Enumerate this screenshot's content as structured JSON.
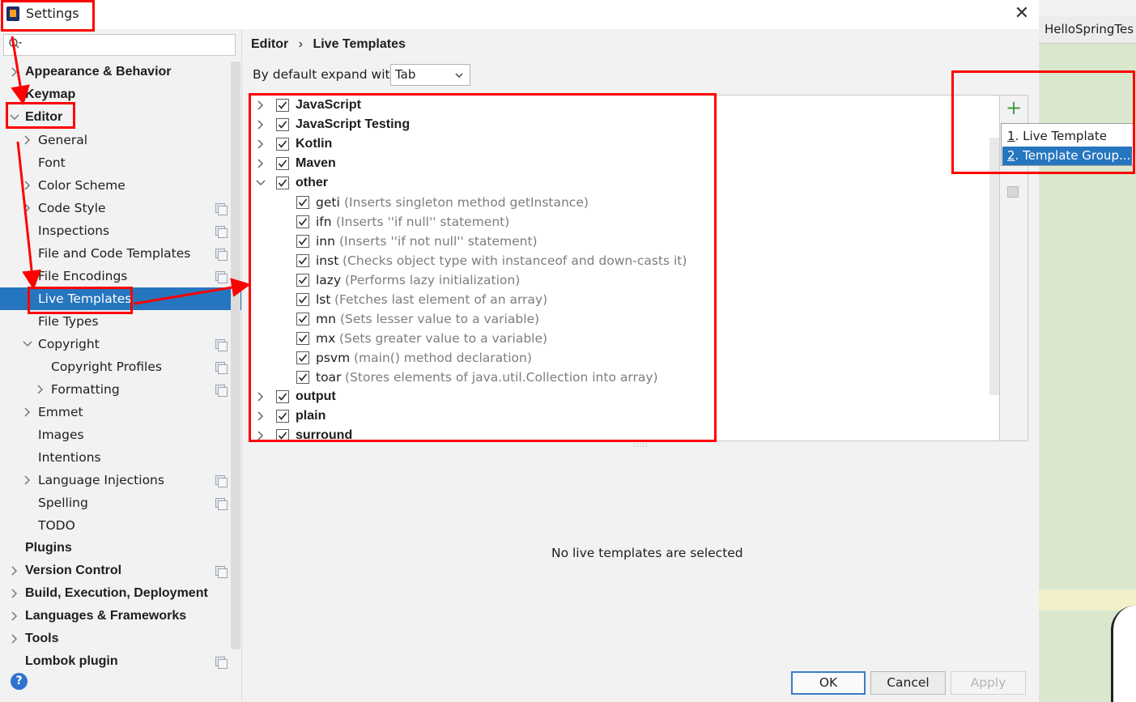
{
  "window": {
    "title": "Settings",
    "close_glyph": "✕"
  },
  "ide": {
    "tab_label": "HelloSpringTes"
  },
  "search": {
    "placeholder": ""
  },
  "sidebar": {
    "items": [
      {
        "label": "Appearance & Behavior",
        "bold": true,
        "arrow": "right"
      },
      {
        "label": "Keymap",
        "bold": true,
        "arrow": ""
      },
      {
        "label": "Editor",
        "bold": true,
        "arrow": "down"
      },
      {
        "label": "General",
        "bold": false,
        "arrow": "right"
      },
      {
        "label": "Font",
        "bold": false,
        "arrow": ""
      },
      {
        "label": "Color Scheme",
        "bold": false,
        "arrow": "right"
      },
      {
        "label": "Code Style",
        "bold": false,
        "arrow": "right",
        "copy": true
      },
      {
        "label": "Inspections",
        "bold": false,
        "arrow": "",
        "copy": true
      },
      {
        "label": "File and Code Templates",
        "bold": false,
        "arrow": "",
        "copy": true
      },
      {
        "label": "File Encodings",
        "bold": false,
        "arrow": "",
        "copy": true
      },
      {
        "label": "Live Templates",
        "bold": false,
        "arrow": "",
        "selected": true
      },
      {
        "label": "File Types",
        "bold": false,
        "arrow": ""
      },
      {
        "label": "Copyright",
        "bold": false,
        "arrow": "down",
        "copy": true
      },
      {
        "label": "Copyright Profiles",
        "bold": false,
        "arrow": "",
        "copy": true
      },
      {
        "label": "Formatting",
        "bold": false,
        "arrow": "right",
        "copy": true
      },
      {
        "label": "Emmet",
        "bold": false,
        "arrow": "right"
      },
      {
        "label": "Images",
        "bold": false,
        "arrow": ""
      },
      {
        "label": "Intentions",
        "bold": false,
        "arrow": ""
      },
      {
        "label": "Language Injections",
        "bold": false,
        "arrow": "right",
        "copy": true
      },
      {
        "label": "Spelling",
        "bold": false,
        "arrow": "",
        "copy": true
      },
      {
        "label": "TODO",
        "bold": false,
        "arrow": ""
      },
      {
        "label": "Plugins",
        "bold": true,
        "arrow": ""
      },
      {
        "label": "Version Control",
        "bold": true,
        "arrow": "right",
        "copy": true
      },
      {
        "label": "Build, Execution, Deployment",
        "bold": true,
        "arrow": "right"
      },
      {
        "label": "Languages & Frameworks",
        "bold": true,
        "arrow": "right"
      },
      {
        "label": "Tools",
        "bold": true,
        "arrow": "right"
      },
      {
        "label": "Lombok plugin",
        "bold": true,
        "arrow": "",
        "copy": true
      }
    ]
  },
  "breadcrumb": {
    "parent": "Editor",
    "separator": "›",
    "current": "Live Templates"
  },
  "expand": {
    "label": "By default expand with",
    "value": "Tab"
  },
  "templates": {
    "rows": [
      {
        "type": "group",
        "name": "JavaScript",
        "expanded": false,
        "checked": true
      },
      {
        "type": "group",
        "name": "JavaScript Testing",
        "expanded": false,
        "checked": true
      },
      {
        "type": "group",
        "name": "Kotlin",
        "expanded": false,
        "checked": true
      },
      {
        "type": "group",
        "name": "Maven",
        "expanded": false,
        "checked": true
      },
      {
        "type": "group",
        "name": "other",
        "expanded": true,
        "checked": true
      },
      {
        "type": "item",
        "name": "geti",
        "desc": "(Inserts singleton method getInstance)",
        "checked": true
      },
      {
        "type": "item",
        "name": "ifn",
        "desc": "(Inserts ''if null'' statement)",
        "checked": true
      },
      {
        "type": "item",
        "name": "inn",
        "desc": "(Inserts ''if not null'' statement)",
        "checked": true
      },
      {
        "type": "item",
        "name": "inst",
        "desc": "(Checks object type with instanceof and down-casts it)",
        "checked": true
      },
      {
        "type": "item",
        "name": "lazy",
        "desc": "(Performs lazy initialization)",
        "checked": true
      },
      {
        "type": "item",
        "name": "lst",
        "desc": "(Fetches last element of an array)",
        "checked": true
      },
      {
        "type": "item",
        "name": "mn",
        "desc": "(Sets lesser value to a variable)",
        "checked": true
      },
      {
        "type": "item",
        "name": "mx",
        "desc": "(Sets greater value to a variable)",
        "checked": true
      },
      {
        "type": "item",
        "name": "psvm",
        "desc": "(main() method declaration)",
        "checked": true
      },
      {
        "type": "item",
        "name": "toar",
        "desc": "(Stores elements of java.util.Collection into array)",
        "checked": true
      },
      {
        "type": "group",
        "name": "output",
        "expanded": false,
        "checked": true
      },
      {
        "type": "group",
        "name": "plain",
        "expanded": false,
        "checked": true
      },
      {
        "type": "group",
        "name": "surround",
        "expanded": false,
        "checked": true
      }
    ]
  },
  "tools": {
    "add_glyph": "+"
  },
  "popup": {
    "items": [
      {
        "mnemonic": "1",
        "label": ". Live Template",
        "selected": false
      },
      {
        "mnemonic": "2",
        "label": ". Template Group...",
        "selected": true
      }
    ]
  },
  "detail": {
    "empty_text": "No live templates are selected"
  },
  "buttons": {
    "ok": "OK",
    "cancel": "Cancel",
    "apply": "Apply",
    "help": "?"
  },
  "colors": {
    "accent": "#2675bf",
    "annotation": "#ff0000",
    "add": "#3f9c3f"
  }
}
